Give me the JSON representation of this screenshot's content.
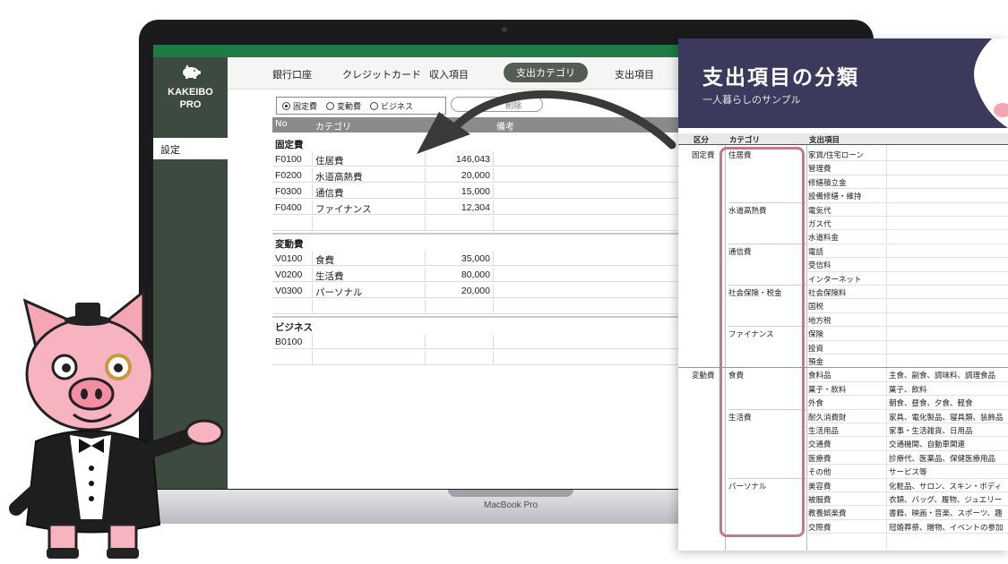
{
  "app": {
    "logo_line1": "KAKEIBO",
    "logo_line2": "PRO",
    "sidebar_settings": "設定",
    "nav": [
      {
        "label": "銀行口座",
        "active": false
      },
      {
        "label": "クレジットカード",
        "active": false
      },
      {
        "label": "収入項目",
        "active": false
      },
      {
        "label": "支出カテゴリ",
        "active": true
      },
      {
        "label": "支出項目",
        "active": false
      }
    ],
    "filters": [
      {
        "label": "固定費",
        "selected": true
      },
      {
        "label": "変動費",
        "selected": false
      },
      {
        "label": "ビジネス",
        "selected": false
      }
    ],
    "delete_label": "削除",
    "columns": {
      "no": "No",
      "category": "カテゴリ",
      "note": "備考"
    },
    "groups": [
      {
        "title": "固定費",
        "rows": [
          {
            "no": "F0100",
            "name": "住居費",
            "amount": "146,043"
          },
          {
            "no": "F0200",
            "name": "水道高熱費",
            "amount": "20,000"
          },
          {
            "no": "F0300",
            "name": "通信費",
            "amount": "15,000"
          },
          {
            "no": "F0400",
            "name": "ファイナンス",
            "amount": "12,304"
          }
        ]
      },
      {
        "title": "変動費",
        "rows": [
          {
            "no": "V0100",
            "name": "食費",
            "amount": "35,000"
          },
          {
            "no": "V0200",
            "name": "生活費",
            "amount": "80,000"
          },
          {
            "no": "V0300",
            "name": "パーソナル",
            "amount": "20,000"
          }
        ]
      },
      {
        "title": "ビジネス",
        "rows": [
          {
            "no": "B0100",
            "name": "",
            "amount": ""
          }
        ]
      }
    ]
  },
  "laptop_label": "MacBook Pro",
  "doc": {
    "title": "支出項目の分類",
    "subtitle": "一人暮らしのサンプル",
    "columns": {
      "kubun": "区分",
      "category": "カテゴリ",
      "item": "支出項目"
    },
    "rows": [
      {
        "kubun": "固定費",
        "category": "住居費",
        "item": "家賃/住宅ローン",
        "note": ""
      },
      {
        "kubun": "",
        "category": "",
        "item": "管理費",
        "note": ""
      },
      {
        "kubun": "",
        "category": "",
        "item": "修繕積立金",
        "note": ""
      },
      {
        "kubun": "",
        "category": "",
        "item": "設備修繕・維持",
        "note": ""
      },
      {
        "kubun": "",
        "category": "水道高熱費",
        "item": "電気代",
        "note": ""
      },
      {
        "kubun": "",
        "category": "",
        "item": "ガス代",
        "note": ""
      },
      {
        "kubun": "",
        "category": "",
        "item": "水道料金",
        "note": ""
      },
      {
        "kubun": "",
        "category": "通信費",
        "item": "電話",
        "note": ""
      },
      {
        "kubun": "",
        "category": "",
        "item": "受信料",
        "note": ""
      },
      {
        "kubun": "",
        "category": "",
        "item": "インターネット",
        "note": ""
      },
      {
        "kubun": "",
        "category": "社会保険・税金",
        "item": "社会保険料",
        "note": ""
      },
      {
        "kubun": "",
        "category": "",
        "item": "国税",
        "note": ""
      },
      {
        "kubun": "",
        "category": "",
        "item": "地方税",
        "note": ""
      },
      {
        "kubun": "",
        "category": "ファイナンス",
        "item": "保険",
        "note": ""
      },
      {
        "kubun": "",
        "category": "",
        "item": "投資",
        "note": ""
      },
      {
        "kubun": "",
        "category": "",
        "item": "預金",
        "note": ""
      },
      {
        "kubun": "変動費",
        "category": "食費",
        "item": "食料品",
        "note": "主食、副食、調味料、調理食品"
      },
      {
        "kubun": "",
        "category": "",
        "item": "菓子・飲料",
        "note": "菓子、飲料"
      },
      {
        "kubun": "",
        "category": "",
        "item": "外食",
        "note": "朝食、昼食、夕食、軽食"
      },
      {
        "kubun": "",
        "category": "生活費",
        "item": "耐久消費財",
        "note": "家具、電化製品、寝具類、装飾品"
      },
      {
        "kubun": "",
        "category": "",
        "item": "生活用品",
        "note": "家事・生活雑貨、日用品"
      },
      {
        "kubun": "",
        "category": "",
        "item": "交通費",
        "note": "交通機関、自動車関連"
      },
      {
        "kubun": "",
        "category": "",
        "item": "医療費",
        "note": "診療代、医薬品、保健医療用品"
      },
      {
        "kubun": "",
        "category": "",
        "item": "その他",
        "note": "サービス等"
      },
      {
        "kubun": "",
        "category": "パーソナル",
        "item": "美容費",
        "note": "化粧品、サロン、スキン・ボディ"
      },
      {
        "kubun": "",
        "category": "",
        "item": "被服費",
        "note": "衣類、バッグ、履物、ジュエリー"
      },
      {
        "kubun": "",
        "category": "",
        "item": "教養娯楽費",
        "note": "書籍、映画・音楽、スポーツ、趣"
      },
      {
        "kubun": "",
        "category": "",
        "item": "交際費",
        "note": "冠婚葬祭、贈物、イベントの参加"
      }
    ]
  }
}
